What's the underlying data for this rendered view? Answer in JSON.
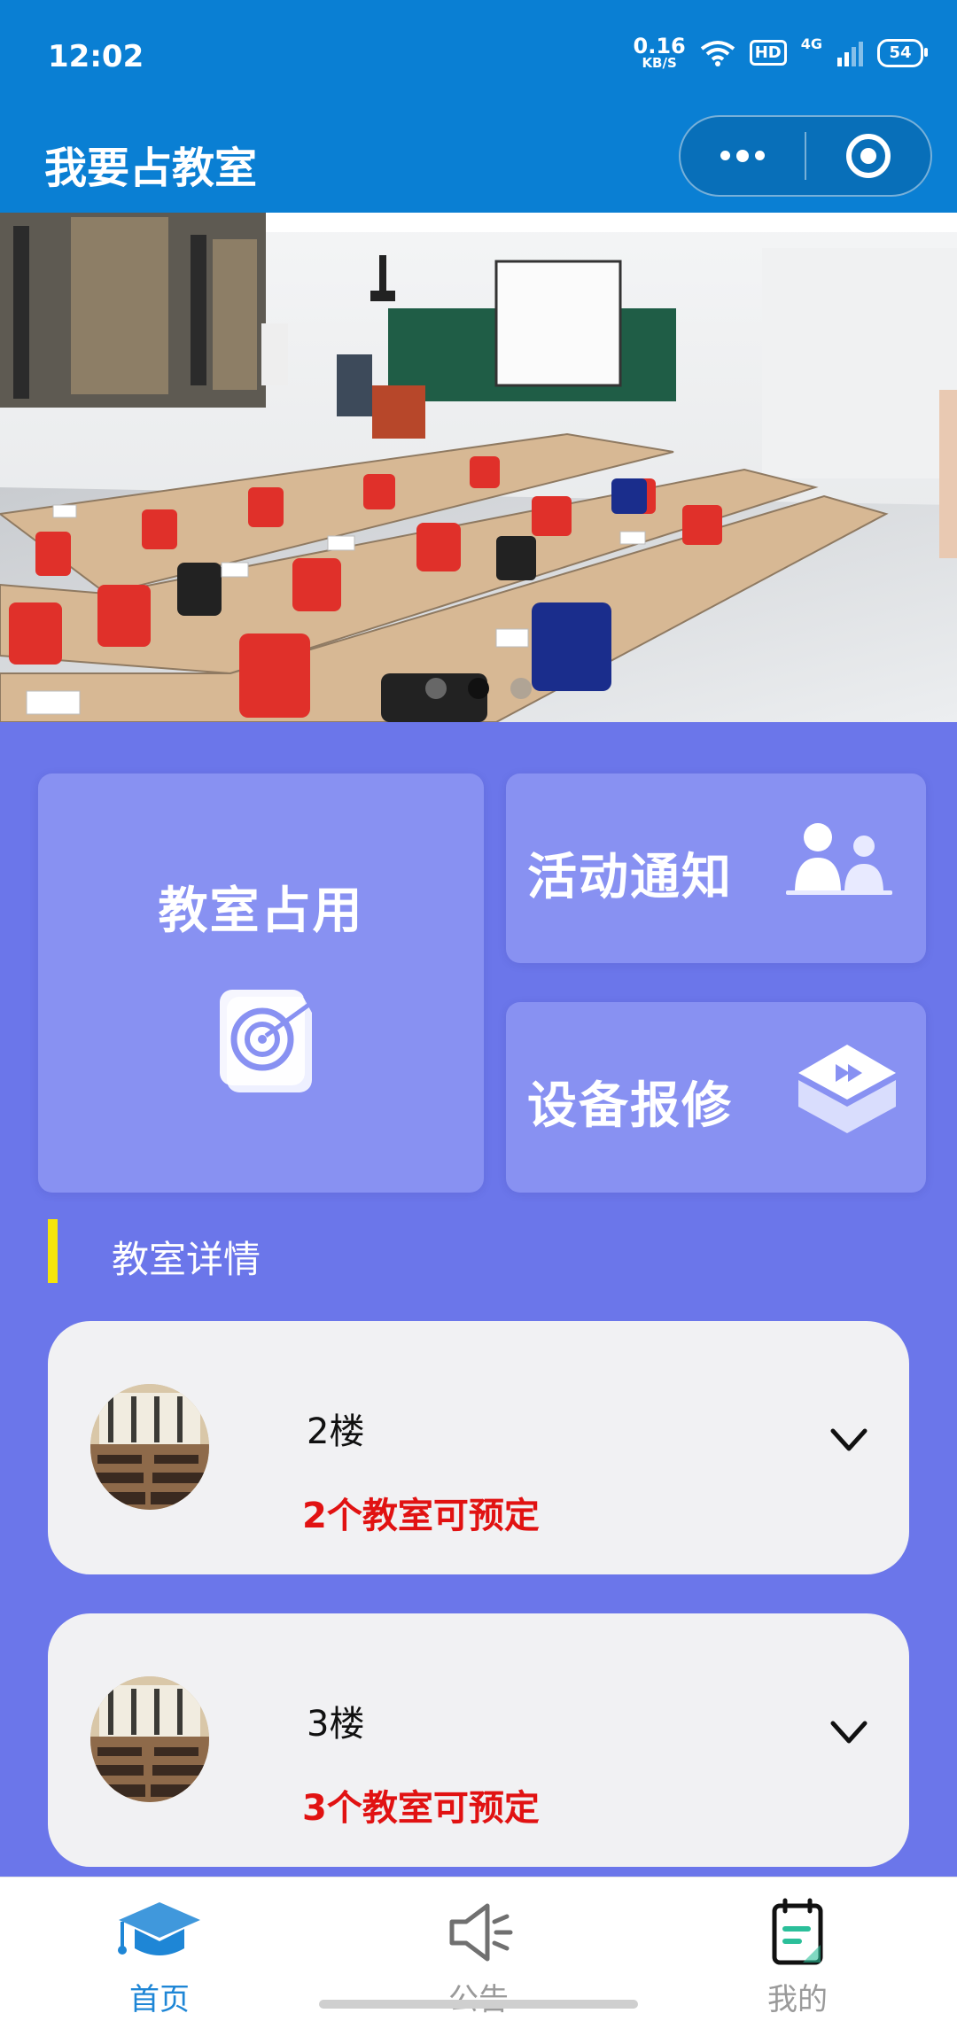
{
  "status_bar": {
    "time": "12:02",
    "net_speed_value": "0.16",
    "net_speed_unit": "KB/S",
    "hd_badge": "HD",
    "network": "4G",
    "battery": "54",
    "icons": [
      "wifi-icon",
      "signal-icon",
      "battery-icon"
    ]
  },
  "nav": {
    "title": "我要占教室",
    "capsule_icons": [
      "more-dots-icon",
      "record-target-icon"
    ]
  },
  "banner": {
    "total_slides": 3,
    "active_slide_index": 1
  },
  "quick_actions": {
    "occupy": {
      "label": "教室占用",
      "icon": "target-icon"
    },
    "activity": {
      "label": "活动通知",
      "icon": "people-icon"
    },
    "repair": {
      "label": "设备报修",
      "icon": "play-cube-icon"
    }
  },
  "section": {
    "title": "教室详情",
    "accent_color": "#f5e50b"
  },
  "floors": [
    {
      "name": "2楼",
      "availability": "2个教室可预定"
    },
    {
      "name": "3楼",
      "availability": "3个教室可预定"
    }
  ],
  "tabbar": {
    "items": [
      {
        "label": "首页",
        "icon": "graduation-cap-icon",
        "active": true
      },
      {
        "label": "公告",
        "icon": "speaker-icon",
        "active": false
      },
      {
        "label": "我的",
        "icon": "notebook-icon",
        "active": false
      }
    ],
    "active_color": "#1e86d6",
    "inactive_color": "#9a9a9a"
  },
  "colors": {
    "header": "#0a7fd3",
    "background": "#6b76ea",
    "card": "#8891f2",
    "availability_text": "#e11212"
  }
}
